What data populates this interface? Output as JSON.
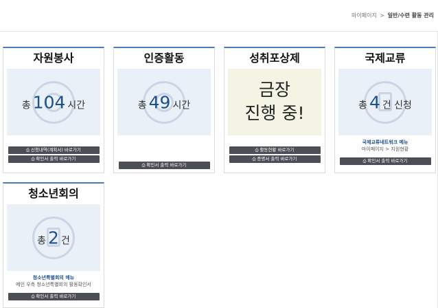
{
  "breadcrumb": {
    "home": "마이페이지",
    "separator": ">",
    "current": "일반/수련 활동 관리"
  },
  "cards": {
    "volunteer": {
      "title": "자원봉사",
      "stat": {
        "prefix": "총",
        "value": "104",
        "unit": "시간"
      },
      "buttons": [
        "신청내역(계획서) 바로가기",
        "확인서 출력 바로가기"
      ]
    },
    "certification": {
      "title": "인증활동",
      "stat": {
        "prefix": "총",
        "value": "49",
        "unit": "시간"
      },
      "buttons": [
        "확인서 출력 바로가기"
      ]
    },
    "achievement": {
      "title": "성취포상제",
      "message": {
        "line1": "금장",
        "line2": "진행 중!"
      },
      "buttons": [
        "활동현황 바로가기",
        "증명서 출력 바로가기"
      ]
    },
    "international": {
      "title": "국제교류",
      "stat": {
        "prefix": "총",
        "value": "4",
        "unit": "건 신청"
      },
      "note_link": "국제교류네트워크 메뉴",
      "note_path": "마이페이지 > 지원현황",
      "buttons": [
        "확인서 출력 바로가기"
      ]
    },
    "youth_council": {
      "title": "청소년회의",
      "stat": {
        "prefix": "총",
        "value": "2",
        "unit": "건"
      },
      "note_link": "청소년특별회의 메뉴",
      "note_path": "메인 우측 청소년특별회의 활동확인서",
      "buttons": [
        "확인서 출력 바로가기"
      ]
    }
  },
  "icons": {
    "button_icon": "printer-icon",
    "volunteer_watermark": "clock-icon",
    "certification_watermark": "clock-icon",
    "international_watermark": "document-icon",
    "youth_council_watermark": "document-icon"
  },
  "colors": {
    "accent": "#4a7bbd",
    "number": "#1e4f8f",
    "button": "#4b4e55",
    "stat_panel": "#e9f0f8",
    "highlight_panel": "#f3f4e3"
  }
}
